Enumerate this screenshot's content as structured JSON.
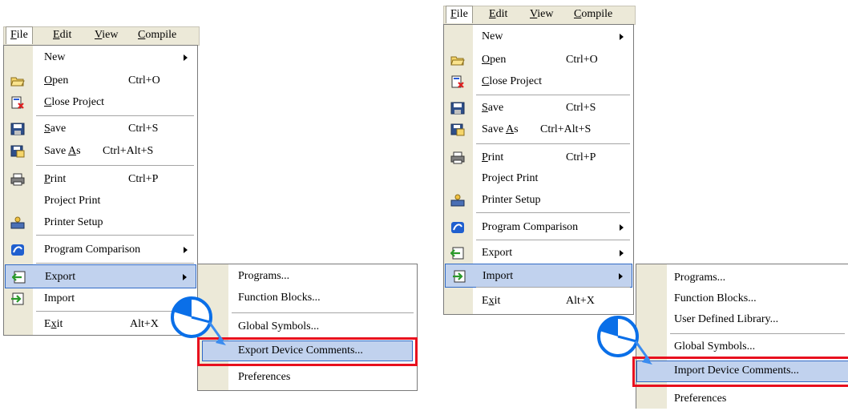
{
  "left": {
    "menubar": [
      {
        "label": "File",
        "ul": "F",
        "rest": "ile",
        "selected": true
      },
      {
        "label": "Edit",
        "ul": "E",
        "rest": "dit"
      },
      {
        "label": "View",
        "ul": "V",
        "rest": "iew"
      },
      {
        "label": "Compile",
        "ul": "C",
        "rest": "ompile"
      }
    ],
    "file_menu": [
      {
        "label": "New",
        "submenu": true
      },
      {
        "label": "Open",
        "ul": "O",
        "rest": "pen",
        "shortcut": "Ctrl+O",
        "icon": "folder-open-icon"
      },
      {
        "label": "Close Project",
        "ul": "C",
        "rest": "lose Project",
        "icon": "close-project-icon"
      },
      {
        "label": "Save",
        "ul": "S",
        "rest": "ave",
        "shortcut": "Ctrl+S",
        "icon": "save-icon"
      },
      {
        "label": "Save As",
        "pre": "Save ",
        "ul": "A",
        "rest": "s",
        "shortcut": "Ctrl+Alt+S",
        "icon": "save-as-icon"
      },
      {
        "label": "Print",
        "ul": "P",
        "rest": "rint",
        "shortcut": "Ctrl+P",
        "icon": "printer-icon"
      },
      {
        "label": "Project Print"
      },
      {
        "label": "Printer Setup",
        "icon": "printer-setup-icon"
      },
      {
        "label": "Program Comparison",
        "submenu": true,
        "icon": "comparison-icon"
      },
      {
        "label": "Export",
        "submenu": true,
        "icon": "export-icon",
        "highlighted": true
      },
      {
        "label": "Import",
        "submenu": true,
        "icon": "import-icon"
      },
      {
        "label": "Exit",
        "pre": "E",
        "ul": "x",
        "rest": "it",
        "shortcut": "Alt+X"
      }
    ],
    "submenu": [
      {
        "label": "Programs..."
      },
      {
        "label": "Function Blocks..."
      },
      {
        "label": "Global Symbols..."
      },
      {
        "label": "Export Device Comments...",
        "highlighted": true
      },
      {
        "label": "Preferences"
      }
    ]
  },
  "right": {
    "menubar": [
      {
        "label": "File",
        "ul": "F",
        "rest": "ile",
        "selected": true
      },
      {
        "label": "Edit",
        "ul": "E",
        "rest": "dit"
      },
      {
        "label": "View",
        "ul": "V",
        "rest": "iew"
      },
      {
        "label": "Compile",
        "ul": "C",
        "rest": "ompile"
      }
    ],
    "file_menu": [
      {
        "label": "New",
        "submenu": true
      },
      {
        "label": "Open",
        "ul": "O",
        "rest": "pen",
        "shortcut": "Ctrl+O",
        "icon": "folder-open-icon"
      },
      {
        "label": "Close Project",
        "ul": "C",
        "rest": "lose Project",
        "icon": "close-project-icon"
      },
      {
        "label": "Save",
        "ul": "S",
        "rest": "ave",
        "shortcut": "Ctrl+S",
        "icon": "save-icon"
      },
      {
        "label": "Save As",
        "pre": "Save ",
        "ul": "A",
        "rest": "s",
        "shortcut": "Ctrl+Alt+S",
        "icon": "save-as-icon"
      },
      {
        "label": "Print",
        "ul": "P",
        "rest": "rint",
        "shortcut": "Ctrl+P",
        "icon": "printer-icon"
      },
      {
        "label": "Project Print"
      },
      {
        "label": "Printer Setup",
        "icon": "printer-setup-icon"
      },
      {
        "label": "Program Comparison",
        "submenu": true,
        "icon": "comparison-icon"
      },
      {
        "label": "Export",
        "submenu": true,
        "icon": "export-icon"
      },
      {
        "label": "Import",
        "submenu": true,
        "icon": "import-icon",
        "highlighted": true
      },
      {
        "label": "Exit",
        "pre": "E",
        "ul": "x",
        "rest": "it",
        "shortcut": "Alt+X"
      }
    ],
    "submenu": [
      {
        "label": "Programs..."
      },
      {
        "label": "Function Blocks..."
      },
      {
        "label": "User Defined Library..."
      },
      {
        "label": "Global Symbols..."
      },
      {
        "label": "Import Device Comments...",
        "highlighted": true
      },
      {
        "label": "Preferences"
      }
    ]
  },
  "colors": {
    "highlight": "#c1d2ee",
    "highlight_border": "#316ac5",
    "callout": "#0a6fe8",
    "red_box": "#e8101e",
    "gutter": "#ece9d8"
  }
}
